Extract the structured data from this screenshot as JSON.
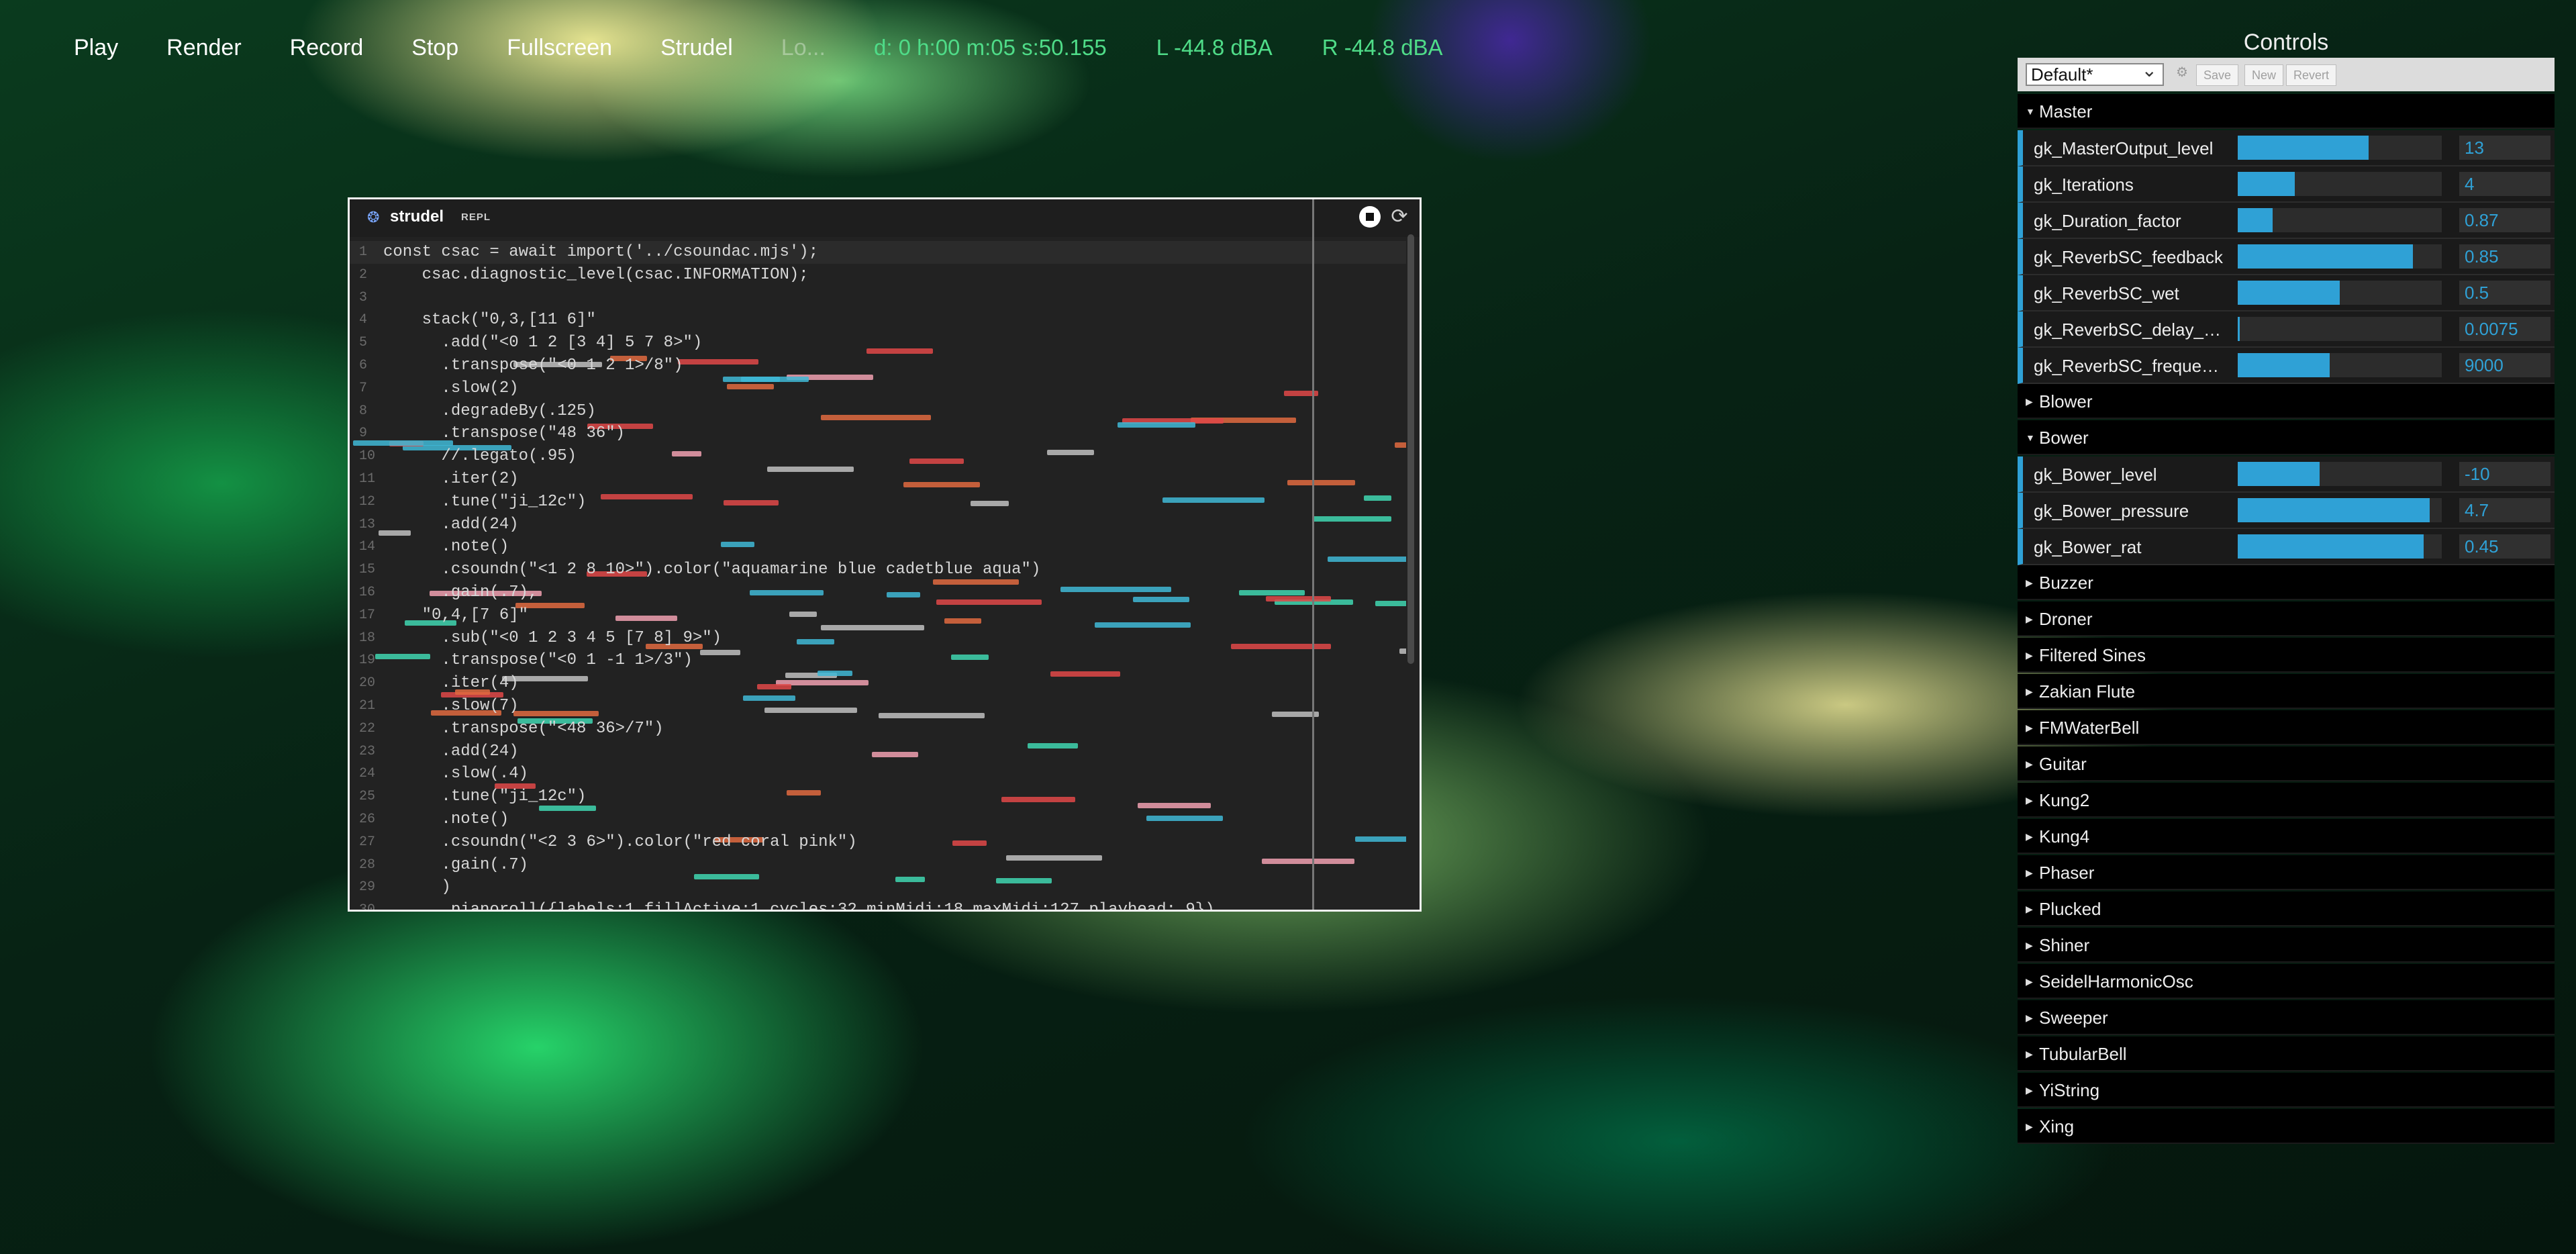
{
  "menu": {
    "items": [
      "Play",
      "Render",
      "Record",
      "Stop",
      "Fullscreen",
      "Strudel"
    ],
    "ghost_item": "Lo...",
    "status_time": "d: 0 h:00 m:05 s:50.155",
    "level_left": "L -44.8 dBA",
    "level_right": "R -44.8 dBA"
  },
  "repl": {
    "title": "strudel",
    "subtitle": "REPL",
    "logo_icon": "strudel-logo-icon",
    "stop_icon": "stop-icon",
    "refresh_icon": "refresh-icon",
    "lines": [
      {
        "n": "1",
        "text": "const csac = await import('../csoundac.mjs');"
      },
      {
        "n": "2",
        "text": "    csac.diagnostic_level(csac.INFORMATION);"
      },
      {
        "n": "3",
        "text": ""
      },
      {
        "n": "4",
        "text": "    stack(\"0,3,[11 6]\""
      },
      {
        "n": "5",
        "text": "      .add(\"<0 1 2 [3 4] 5 7 8>\")"
      },
      {
        "n": "6",
        "text": "      .transpose(\"<0 1 2 1>/8\")"
      },
      {
        "n": "7",
        "text": "      .slow(2)"
      },
      {
        "n": "8",
        "text": "      .degradeBy(.125)"
      },
      {
        "n": "9",
        "text": "      .transpose(\"48 36\")"
      },
      {
        "n": "10",
        "text": "      //.legato(.95)"
      },
      {
        "n": "11",
        "text": "      .iter(2)"
      },
      {
        "n": "12",
        "text": "      .tune(\"ji_12c\")"
      },
      {
        "n": "13",
        "text": "      .add(24)"
      },
      {
        "n": "14",
        "text": "      .note()"
      },
      {
        "n": "15",
        "text": "      .csoundn(\"<1 2 8 10>\").color(\"aquamarine blue cadetblue aqua\")"
      },
      {
        "n": "16",
        "text": "      .gain(.7),"
      },
      {
        "n": "17",
        "text": "    \"0,4,[7 6]\""
      },
      {
        "n": "18",
        "text": "      .sub(\"<0 1 2 3 4 5 [7 8] 9>\")"
      },
      {
        "n": "19",
        "text": "      .transpose(\"<0 1 -1 1>/3\")"
      },
      {
        "n": "20",
        "text": "      .iter(4)"
      },
      {
        "n": "21",
        "text": "      .slow(7)"
      },
      {
        "n": "22",
        "text": "      .transpose(\"<48 36>/7\")"
      },
      {
        "n": "23",
        "text": "      .add(24)"
      },
      {
        "n": "24",
        "text": "      .slow(.4)"
      },
      {
        "n": "25",
        "text": "      .tune(\"ji_12c\")"
      },
      {
        "n": "26",
        "text": "      .note()"
      },
      {
        "n": "27",
        "text": "      .csoundn(\"<2 3 6>\").color(\"red coral pink\")"
      },
      {
        "n": "28",
        "text": "      .gain(.7)"
      },
      {
        "n": "29",
        "text": "      )"
      },
      {
        "n": "30",
        "text": "      .pianoroll({labels:1,fillActive:1,cycles:32,minMidi:18,maxMidi:127,playhead:.9})"
      }
    ]
  },
  "controls": {
    "title": "Controls",
    "preset": "Default*",
    "gear_icon": "gear-icon",
    "save_label": "Save",
    "new_label": "New",
    "revert_label": "Revert",
    "accent_color": "#2fa1d6",
    "master": {
      "name": "Master",
      "params": [
        {
          "name": "gk_MasterOutput_level",
          "value": "13",
          "fraction": 0.64
        },
        {
          "name": "gk_Iterations",
          "value": "4",
          "fraction": 0.28
        },
        {
          "name": "gk_Duration_factor",
          "value": "0.87",
          "fraction": 0.17
        },
        {
          "name": "gk_ReverbSC_feedback",
          "value": "0.85",
          "fraction": 0.86
        },
        {
          "name": "gk_ReverbSC_wet",
          "value": "0.5",
          "fraction": 0.5
        },
        {
          "name": "gk_ReverbSC_delay_m...",
          "value": "0.0075",
          "fraction": 0.01
        },
        {
          "name": "gk_ReverbSC_frequenc...",
          "value": "9000",
          "fraction": 0.45
        }
      ]
    },
    "blower": {
      "name": "Blower"
    },
    "bower": {
      "name": "Bower",
      "params": [
        {
          "name": "gk_Bower_level",
          "value": "-10",
          "fraction": 0.4
        },
        {
          "name": "gk_Bower_pressure",
          "value": "4.7",
          "fraction": 0.94
        },
        {
          "name": "gk_Bower_rat",
          "value": "0.45",
          "fraction": 0.91
        }
      ]
    },
    "folders": [
      "Buzzer",
      "Droner",
      "Filtered Sines",
      "Zakian Flute",
      "FMWaterBell",
      "Guitar",
      "Kung2",
      "Kung4",
      "Phaser",
      "Plucked",
      "Shiner",
      "SeidelHarmonicOsc",
      "Sweeper",
      "TubularBell",
      "YiString",
      "Xing"
    ]
  }
}
